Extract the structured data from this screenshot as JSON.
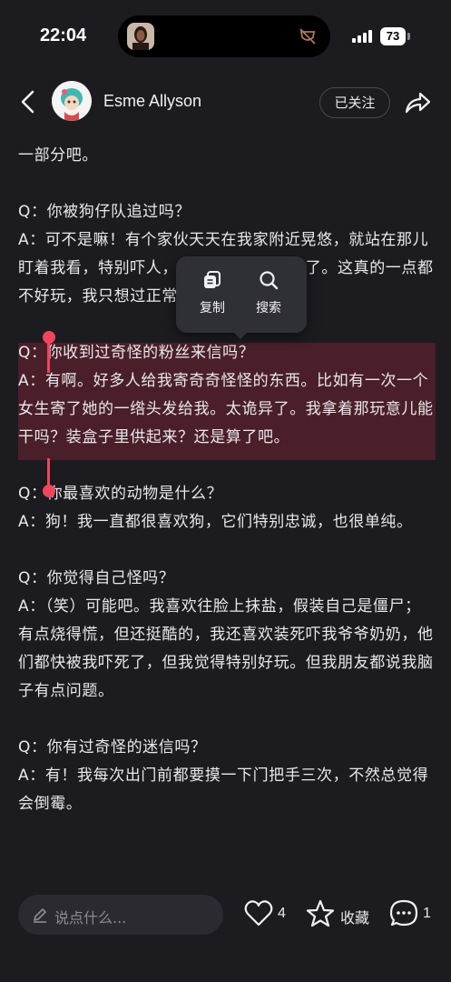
{
  "status_bar": {
    "time": "22:04",
    "battery": "73"
  },
  "header": {
    "author_name": "Esme Allyson",
    "follow_label": "已关注"
  },
  "article": {
    "paragraphs": [
      {
        "text": "一部分吧。"
      },
      {
        "text": ""
      },
      {
        "text": "Q：你被狗仔队追过吗？"
      },
      {
        "text": "A：可不是嘛！有个家伙天天在我家附近晃悠，就站在那儿盯着我看，特别吓人，我都报警过一两次了。这真的一点都不好玩，我只想过正常人的日子。"
      },
      {
        "text": ""
      },
      {
        "text": "Q：你收到过奇怪的粉丝来信吗？"
      },
      {
        "text": "A：有啊。好多人给我寄奇奇怪怪的东西。比如有一次一个女生寄了她的一绺头发给我。太诡异了。我拿着那玩意儿能干吗？装盒子里供起来？还是算了吧。"
      },
      {
        "text": ""
      },
      {
        "text": "Q：你最喜欢的动物是什么？"
      },
      {
        "text": "A：狗！我一直都很喜欢狗，它们特别忠诚，也很单纯。"
      },
      {
        "text": ""
      },
      {
        "text": "Q：你觉得自己怪吗？"
      },
      {
        "text": "A：（笑）可能吧。我喜欢往脸上抹盐，假装自己是僵尸；有点烧得慌，但还挺酷的，我还喜欢装死吓我爷爷奶奶，他们都快被我吓死了，但我觉得特别好玩。但我朋友都说我脑子有点问题。"
      },
      {
        "text": ""
      },
      {
        "text": "Q：你有过奇怪的迷信吗？"
      },
      {
        "text": "A：有！我每次出门前都要摸一下门把手三次，不然总觉得会倒霉。"
      }
    ]
  },
  "selection_menu": {
    "copy_label": "复制",
    "search_label": "搜索"
  },
  "bottom_bar": {
    "comment_placeholder": "说点什么...",
    "like_count": "4",
    "favorite_label": "收藏",
    "comment_count": "1"
  },
  "colors": {
    "background": "#1c1b20",
    "text": "#e9e8ec",
    "selection_highlight": "#4a1f2a",
    "selection_handle": "#f0455c",
    "popup_bg": "#2f2f36"
  }
}
